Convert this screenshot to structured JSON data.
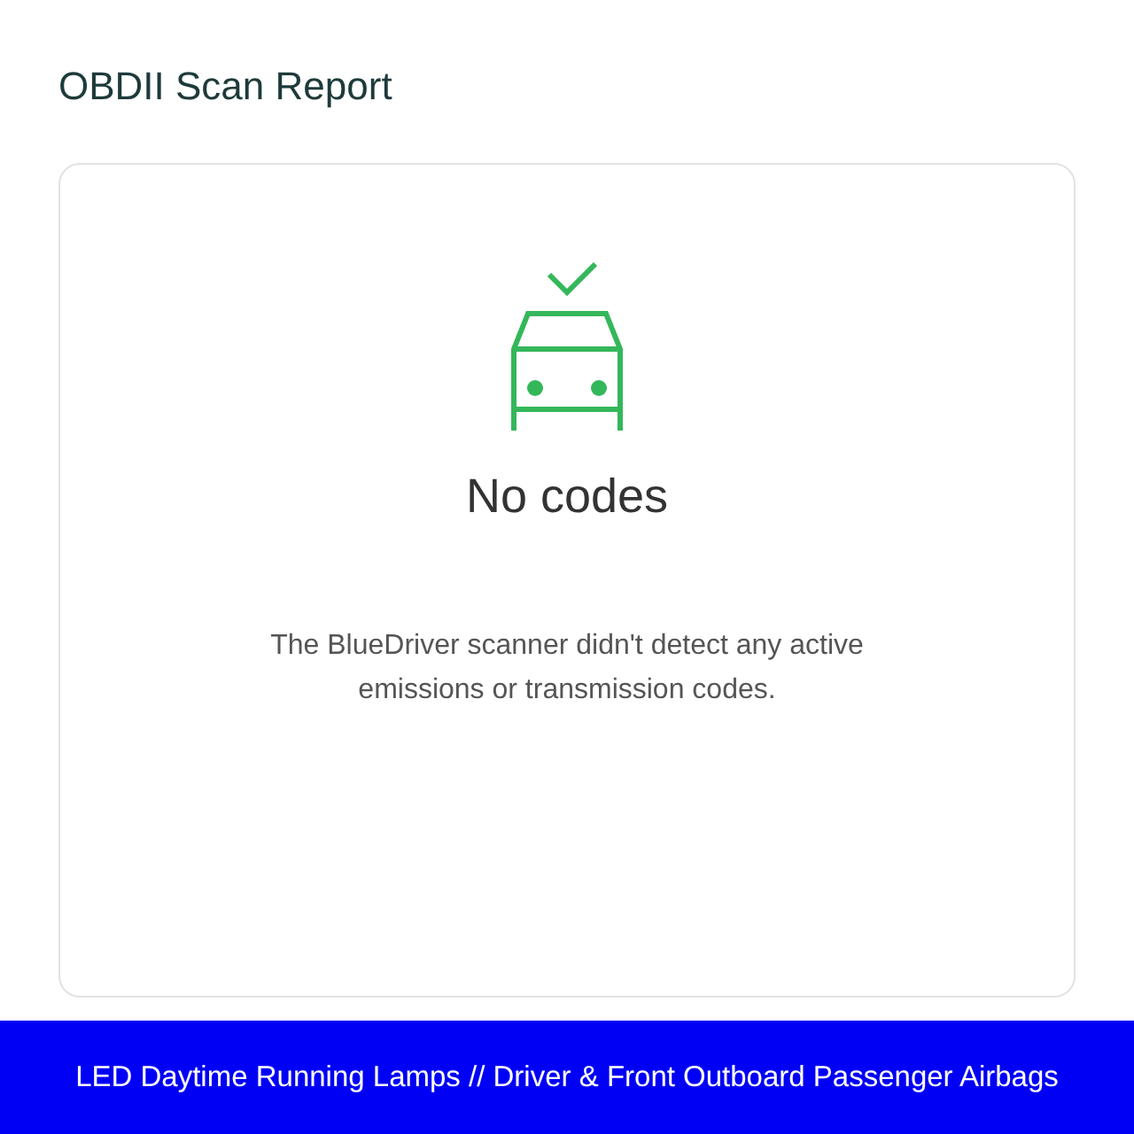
{
  "page": {
    "title": "OBDII Scan Report"
  },
  "result": {
    "heading": "No codes",
    "message": "The BlueDriver scanner didn't detect any active emissions or transmission codes."
  },
  "banner": {
    "text": "LED Daytime Running Lamps // Driver & Front Outboard Passenger Airbags"
  }
}
